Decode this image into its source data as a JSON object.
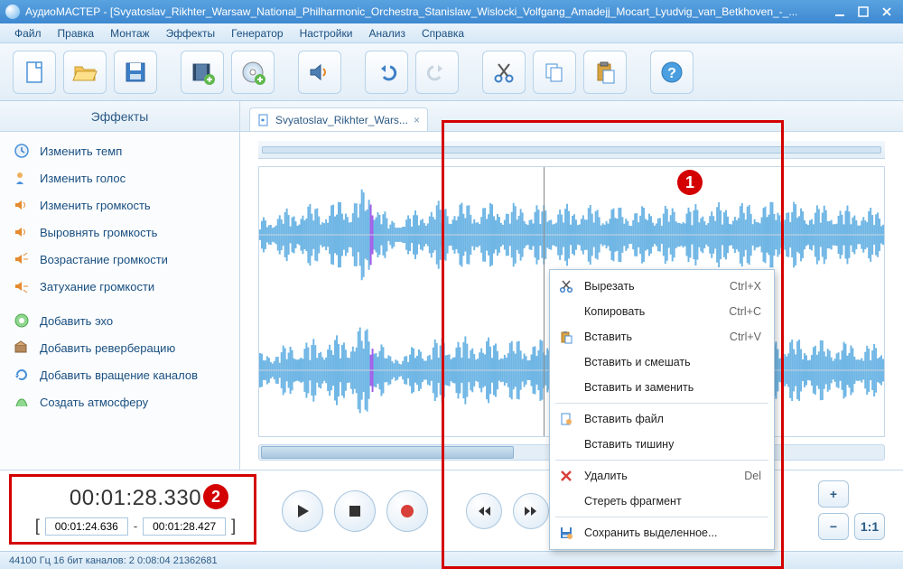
{
  "window": {
    "title": "АудиоМАСТЕР - [Svyatoslav_Rikhter_Warsaw_National_Philharmonic_Orchestra_Stanislaw_Wislocki_Volfgang_Amadejj_Mocart_Lyudvig_van_Betkhoven_-_..."
  },
  "menu": {
    "file": "Файл",
    "edit": "Правка",
    "montage": "Монтаж",
    "effects": "Эффекты",
    "generator": "Генератор",
    "settings": "Настройки",
    "analysis": "Анализ",
    "help": "Справка"
  },
  "sidebar": {
    "header": "Эффекты",
    "items": [
      {
        "icon": "clock",
        "label": "Изменить темп"
      },
      {
        "icon": "voice",
        "label": "Изменить голос"
      },
      {
        "icon": "vol",
        "label": "Изменить громкость"
      },
      {
        "icon": "vol",
        "label": "Выровнять громкость"
      },
      {
        "icon": "volup",
        "label": "Возрастание громкости"
      },
      {
        "icon": "voldown",
        "label": "Затухание громкости"
      },
      {
        "icon": "echo",
        "label": "Добавить эхо"
      },
      {
        "icon": "reverb",
        "label": "Добавить реверберацию"
      },
      {
        "icon": "rotate",
        "label": "Добавить вращение каналов"
      },
      {
        "icon": "atmos",
        "label": "Создать атмосферу"
      }
    ]
  },
  "tab": {
    "label": "Svyatoslav_Rikhter_Wars..."
  },
  "time": {
    "current": "00:01:28.330",
    "sel_start": "00:01:24.636",
    "sel_end": "00:01:28.427",
    "dash": "-"
  },
  "zoom": {
    "ratio": "1:1"
  },
  "status": {
    "text": "44100 Гц  16 бит  каналов: 2   0:08:04  21362681"
  },
  "context_menu": {
    "items": [
      {
        "icon": "cut",
        "label": "Вырезать",
        "shortcut": "Ctrl+X"
      },
      {
        "icon": "",
        "label": "Копировать",
        "shortcut": "Ctrl+C"
      },
      {
        "icon": "paste",
        "label": "Вставить",
        "shortcut": "Ctrl+V"
      },
      {
        "icon": "",
        "label": "Вставить и смешать",
        "shortcut": ""
      },
      {
        "icon": "",
        "label": "Вставить и заменить",
        "shortcut": ""
      },
      {
        "sep": true
      },
      {
        "icon": "file",
        "label": "Вставить файл",
        "shortcut": ""
      },
      {
        "icon": "",
        "label": "Вставить тишину",
        "shortcut": ""
      },
      {
        "sep": true
      },
      {
        "icon": "delete",
        "label": "Удалить",
        "shortcut": "Del"
      },
      {
        "icon": "",
        "label": "Стереть фрагмент",
        "shortcut": ""
      },
      {
        "sep": true
      },
      {
        "icon": "save",
        "label": "Сохранить выделенное...",
        "shortcut": ""
      }
    ]
  },
  "annotations": {
    "a1": "1",
    "a2": "2"
  },
  "chart_data": {
    "type": "line",
    "note": "Stereo audio waveform display (schematic amplitude estimates from pixels)",
    "duration_seconds": 484,
    "selection": {
      "start_s": 84.636,
      "end_s": 88.427
    },
    "playhead_s": 88.33,
    "channels": 2,
    "x_unit": "seconds",
    "waveform_envelope_normalized": [
      {
        "t": 0,
        "amp": 0.3
      },
      {
        "t": 20,
        "amp": 0.45
      },
      {
        "t": 40,
        "amp": 0.55
      },
      {
        "t": 60,
        "amp": 0.6
      },
      {
        "t": 80,
        "amp": 0.8
      },
      {
        "t": 88,
        "amp": 0.85
      },
      {
        "t": 100,
        "amp": 0.25
      },
      {
        "t": 140,
        "amp": 0.6
      },
      {
        "t": 200,
        "amp": 0.55
      },
      {
        "t": 300,
        "amp": 0.5
      },
      {
        "t": 400,
        "amp": 0.6
      },
      {
        "t": 484,
        "amp": 0.45
      }
    ]
  }
}
